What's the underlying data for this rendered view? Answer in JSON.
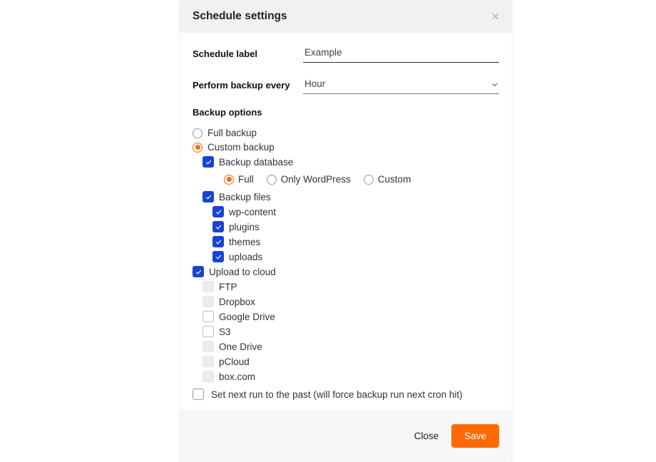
{
  "header": {
    "title": "Schedule settings"
  },
  "form": {
    "schedule_label_label": "Schedule label",
    "schedule_label_value": "Example",
    "perform_label": "Perform backup every",
    "perform_value": "Hour"
  },
  "backup": {
    "section_title": "Backup options",
    "full_backup_label": "Full backup",
    "full_backup_selected": false,
    "custom_backup_label": "Custom backup",
    "custom_backup_selected": true,
    "backup_database_label": "Backup database",
    "backup_database_checked": true,
    "db_scope": {
      "full": "Full",
      "full_selected": true,
      "only_wp": "Only WordPress",
      "only_wp_selected": false,
      "custom": "Custom",
      "custom_selected": false
    },
    "backup_files_label": "Backup files",
    "backup_files_checked": true,
    "files": [
      {
        "label": "wp-content",
        "checked": true
      },
      {
        "label": "plugins",
        "checked": true
      },
      {
        "label": "themes",
        "checked": true
      },
      {
        "label": "uploads",
        "checked": true
      }
    ],
    "upload_cloud_label": "Upload to cloud",
    "upload_cloud_checked": true,
    "cloud": [
      {
        "label": "FTP",
        "checked": false,
        "disabled": true
      },
      {
        "label": "Dropbox",
        "checked": false,
        "disabled": true
      },
      {
        "label": "Google Drive",
        "checked": false,
        "disabled": false
      },
      {
        "label": "S3",
        "checked": false,
        "disabled": false
      },
      {
        "label": "One Drive",
        "checked": false,
        "disabled": true
      },
      {
        "label": "pCloud",
        "checked": false,
        "disabled": true
      },
      {
        "label": "box.com",
        "checked": false,
        "disabled": true
      }
    ]
  },
  "past_run_label": "Set next run to the past (will force backup run next cron hit)",
  "past_run_checked": false,
  "footer": {
    "close": "Close",
    "save": "Save"
  }
}
